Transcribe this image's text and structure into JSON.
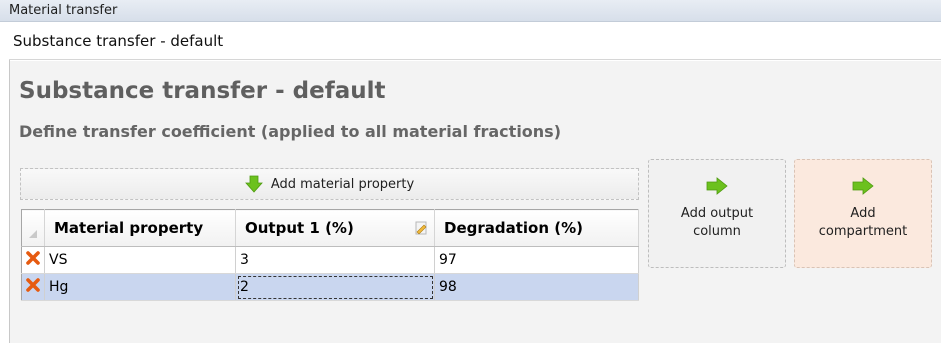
{
  "window": {
    "title": "Material transfer"
  },
  "selector": {
    "value": "Substance transfer - default"
  },
  "main": {
    "heading": "Substance transfer - default",
    "subheading": "Define transfer coefficient (applied to all material fractions)",
    "add_property_label": "Add material property",
    "add_output_label": "Add output column",
    "add_compartment_label": "Add compartment"
  },
  "table": {
    "columns": [
      "Material property",
      "Output 1 (%)",
      "Degradation (%)"
    ],
    "rows": [
      {
        "property": "VS",
        "output1": "3",
        "degradation": "97"
      },
      {
        "property": "Hg",
        "output1": "2",
        "degradation": "98"
      }
    ],
    "selected_row": 1
  },
  "icons": {
    "delete": "delete-x-icon",
    "add_down": "green-down-arrow-icon",
    "add_right": "green-right-arrow-icon",
    "edit": "pencil-icon"
  },
  "colors": {
    "accent_green": "#6cc11e",
    "delete_orange": "#e65a10",
    "selected_row": "#c9d6ef",
    "compartment_tile": "#fbe9de"
  }
}
